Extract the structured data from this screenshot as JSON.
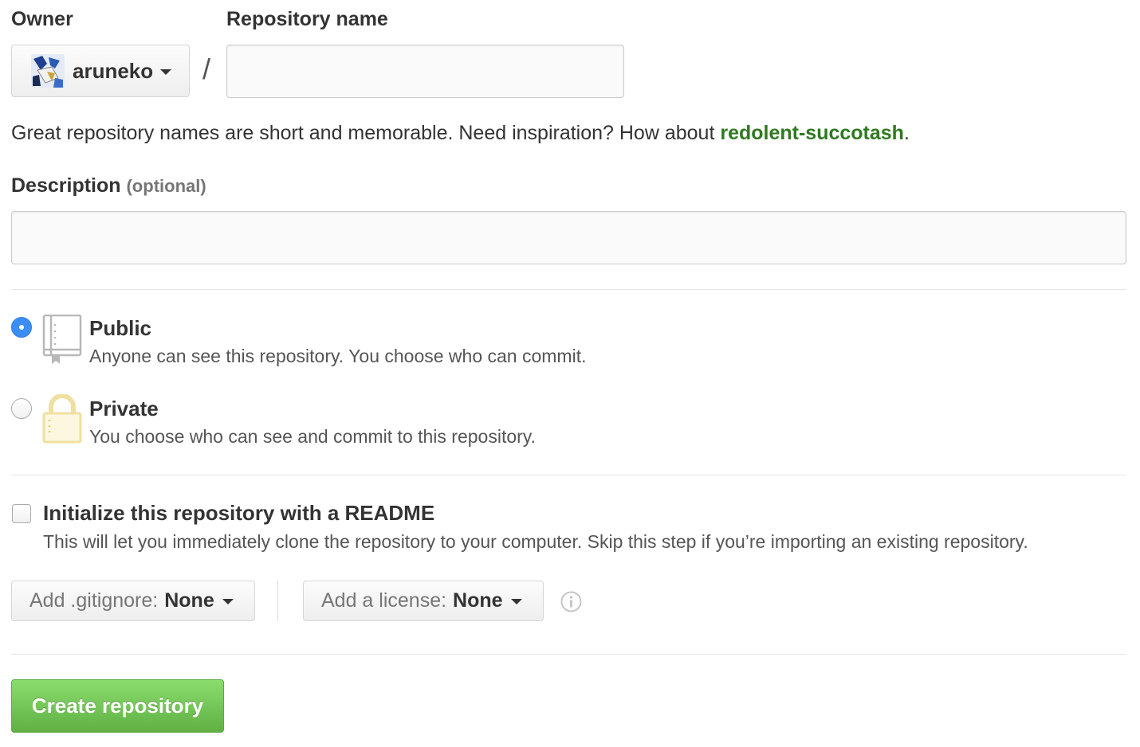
{
  "owner": {
    "label": "Owner",
    "name": "aruneko",
    "avatar_icon": "user-avatar"
  },
  "repository": {
    "label": "Repository name",
    "value": "",
    "separator": "/"
  },
  "suggestion": {
    "prefix": "Great repository names are short and memorable. Need inspiration? How about ",
    "name": "redolent-succotash",
    "suffix": "."
  },
  "description": {
    "label": "Description",
    "optional_label": "(optional)",
    "value": ""
  },
  "visibility": {
    "public": {
      "title": "Public",
      "desc": "Anyone can see this repository. You choose who can commit.",
      "icon": "repo-book-icon",
      "checked": true
    },
    "private": {
      "title": "Private",
      "desc": "You choose who can see and commit to this repository.",
      "icon": "lock-icon",
      "checked": false
    }
  },
  "readme": {
    "title": "Initialize this repository with a README",
    "desc": "This will let you immediately clone the repository to your computer. Skip this step if you’re importing an existing repository.",
    "checked": false
  },
  "gitignore": {
    "label": "Add .gitignore:",
    "value": "None"
  },
  "license": {
    "label": "Add a license:",
    "value": "None"
  },
  "create_button": "Create repository",
  "colors": {
    "suggestion_green": "#2e7a1f",
    "create_green": "#60b044",
    "radio_blue": "#3b8ef4",
    "lock_yellow": "#f3e3a7"
  }
}
